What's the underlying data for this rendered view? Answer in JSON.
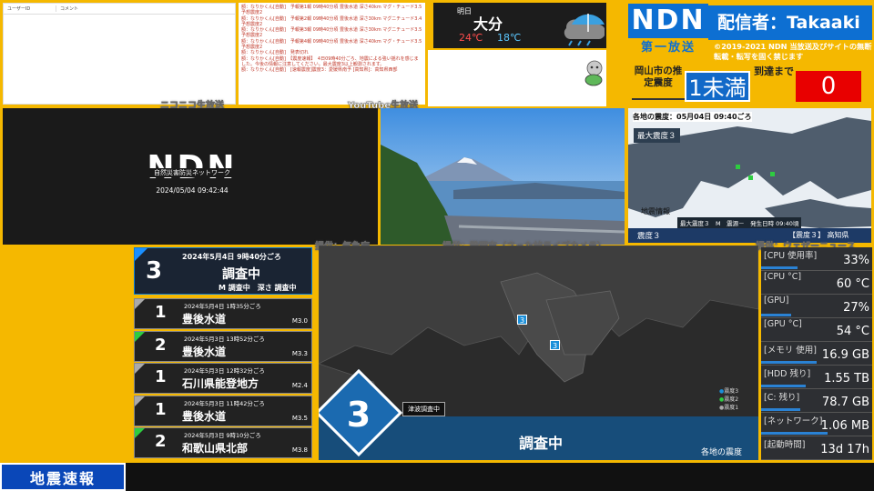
{
  "nico": {
    "col1": "ユーザーID",
    "col2": "コメント",
    "caption": "ニコニコ生放送"
  },
  "youtube": {
    "caption": "YouTube生放送",
    "messages": [
      "額：なりかくん[自動]　予報第1報 09時40分頃 豊後水道 深さ40km マグ・チュード3.5 予想震度2",
      "額：なりかくん[自動]　予報第2報 09時40分頃 豊後水道 深さ30km マグニチュード3.4 予想震度2",
      "額：なりかくん[自動]　予報第3報 09時40分頃 豊後水道 深さ30km マグニチュード3.5 予想震度2",
      "額：なりかくん[自動]　予報第4報 09時40分頃 豊後水道 深さ40km マグ・チュード3.5 予想震度2",
      "額：なりかくん[自動]　発表切れ",
      "額：なりかくん[自動]　【震度速報】　4日09時40分ごろ、地震による強い揺れを感じました。今後の情報に注意してください。最大震度3以上観測されます。",
      "額：なりかくん[自動]　[速報震度]震度3：愛媛県南予 [高知県]：高知県西部"
    ]
  },
  "weather": {
    "label": "明日",
    "city": "大分",
    "high": "24℃",
    "low": "18℃"
  },
  "header": {
    "logo": "NDN",
    "streamer": "配信者：Takaaki",
    "broadcast": "第一放送",
    "copyright": "©2019-2021 NDN 当放送及びサイトの無断転載・転写を固く禁じます",
    "intensity_label": "岡山市の推定震度",
    "intensity_value": "1未満",
    "arrival_label": "到達まで",
    "arrival_value": "0"
  },
  "ndnvideo": {
    "logo": "NDN",
    "subtitle": "自然災害防災ネットワーク",
    "datetime": "2024/05/04 09:42:44",
    "caption": "提供：気象庁"
  },
  "camera": {
    "caption": "提供：静岡市（さった峠ライブカメラ）"
  },
  "mapsmall": {
    "title": "各地の震度：05月04日 09:40ごろ",
    "maxlabel": "最大震度３",
    "info": "地震情報",
    "footer": "最大震度３　M　震源－　発生日時 09:40頃",
    "shindo": "震度３",
    "ticker": "【震度３】 高知県",
    "caption": "提供：ウェザーニュース"
  },
  "eqtop": {
    "intensity": "3",
    "datetime": "2024年5月4日 9時40分ごろ",
    "place": "調査中",
    "detail": "M 調査中　深さ 調査中"
  },
  "eqlist": [
    {
      "intensity": "1",
      "datetime": "2024年5月4日 1時35分ごろ",
      "place": "豊後水道",
      "mag": "M3.0",
      "color": "#aaaaaa"
    },
    {
      "intensity": "2",
      "datetime": "2024年5月3日 13時52分ごろ",
      "place": "豊後水道",
      "mag": "M3.3",
      "color": "#2ecc40"
    },
    {
      "intensity": "1",
      "datetime": "2024年5月3日 12時32分ごろ",
      "place": "石川県能登地方",
      "mag": "M2.4",
      "color": "#aaaaaa"
    },
    {
      "intensity": "1",
      "datetime": "2024年5月3日 11時42分ごろ",
      "place": "豊後水道",
      "mag": "M3.5",
      "color": "#aaaaaa"
    },
    {
      "intensity": "2",
      "datetime": "2024年5月3日 9時10分ごろ",
      "place": "和歌山県北部",
      "mag": "M3.8",
      "color": "#2ecc40"
    }
  ],
  "bigmap": {
    "intensity": "3",
    "tsunami": "津波調査中",
    "place": "調査中",
    "footer": "各地の震度",
    "marker1": "3",
    "marker2": "3",
    "legend": [
      "震度3",
      "震度2",
      "震度1"
    ]
  },
  "stats": [
    {
      "label": "[CPU 使用率]",
      "value": "33%",
      "fill": 0.33
    },
    {
      "label": "[CPU °C]",
      "value": "60 °C",
      "fill": 0.0
    },
    {
      "label": "[GPU]",
      "value": "27%",
      "fill": 0.27
    },
    {
      "label": "[GPU °C]",
      "value": "54 °C",
      "fill": 0.0
    },
    {
      "label": "[メモリ 使用]",
      "value": "16.9 GB",
      "fill": 0.5
    },
    {
      "label": "[HDD 残り]",
      "value": "1.55 TB",
      "fill": 0.4
    },
    {
      "label": "[C: 残り]",
      "value": "78.7 GB",
      "fill": 0.35
    },
    {
      "label": "[ネットワーク]",
      "value": "1.06 MB",
      "fill": 0.6
    },
    {
      "label": "[起動時間]",
      "value": "13d 17h",
      "fill": 0.0
    }
  ],
  "ticker": {
    "label": "地震速報"
  }
}
